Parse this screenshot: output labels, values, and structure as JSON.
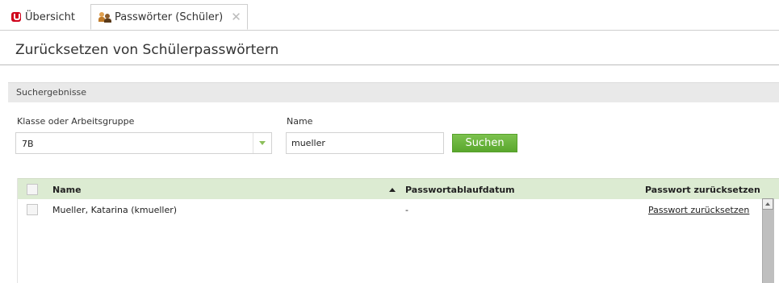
{
  "tabs": [
    {
      "label": "Übersicht",
      "icon": "univention-logo-icon"
    },
    {
      "label": "Passwörter (Schüler)",
      "icon": "users-icon",
      "close_icon": "close-icon"
    }
  ],
  "page": {
    "title": "Zurücksetzen von Schülerpasswörtern"
  },
  "panel": {
    "title": "Suchergebnisse"
  },
  "filters": {
    "class_label": "Klasse oder Arbeitsgruppe",
    "class_value": "7B",
    "name_label": "Name",
    "name_value": "mueller",
    "search_button": "Suchen"
  },
  "grid": {
    "columns": [
      "Name",
      "Passwortablaufdatum",
      "Passwort zurücksetzen"
    ],
    "sort": {
      "column": "Name",
      "direction": "ascending"
    },
    "rows": [
      {
        "name": "Mueller, Katarina (kmueller)",
        "expiry": "-",
        "action": "Passwort zurücksetzen"
      }
    ]
  },
  "colors": {
    "accent_green": "#5aa72d",
    "header_green": "#dcebd2",
    "logo_red": "#d0021b"
  }
}
